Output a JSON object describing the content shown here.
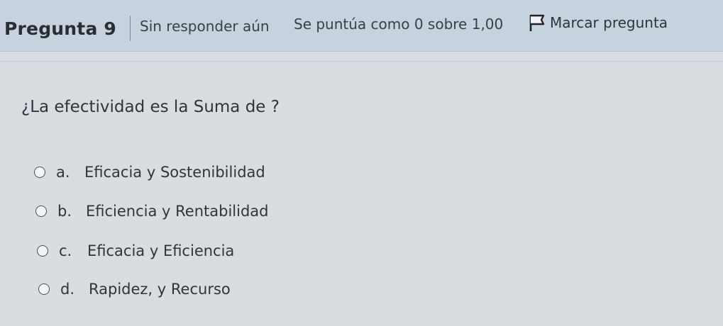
{
  "header": {
    "question_label": "Pregunta 9",
    "status": "Sin responder aún",
    "grade": "Se puntúa como 0 sobre 1,00",
    "flag_label": "Marcar pregunta",
    "flag_icon": "flag-outline-icon"
  },
  "question": {
    "text": "¿La efectividad es la Suma de ?"
  },
  "answers": [
    {
      "letter": "a.",
      "text": "Eficacia y Sostenibilidad",
      "selected": false
    },
    {
      "letter": "b.",
      "text": "Eficiencia y Rentabilidad",
      "selected": false
    },
    {
      "letter": "c.",
      "text": "Eficacia y Eficiencia",
      "selected": false
    },
    {
      "letter": "d.",
      "text": "Rapidez, y Recurso",
      "selected": false
    }
  ],
  "colors": {
    "header_bg": "#c6d3de",
    "page_bg": "#d9dde1",
    "text": "#2b2f33"
  }
}
